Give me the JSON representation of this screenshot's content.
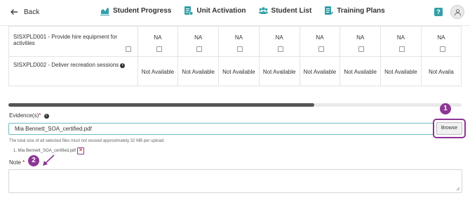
{
  "header": {
    "back_label": "Back",
    "nav": [
      {
        "label": "Student Progress",
        "icon": "chart-icon"
      },
      {
        "label": "Unit Activation",
        "icon": "document-icon"
      },
      {
        "label": "Student List",
        "icon": "users-icon"
      },
      {
        "label": "Training Plans",
        "icon": "document-list-icon"
      }
    ],
    "help_icon": "?"
  },
  "table": {
    "rows": [
      {
        "unit": "SISXPLD001 - Provide hire equipment for activities",
        "values": [
          "NA",
          "NA",
          "NA",
          "NA",
          "NA",
          "NA",
          "NA",
          "NA"
        ]
      },
      {
        "unit": "SISXPLD002 - Deliver recreation sessions",
        "values": [
          "Not Available",
          "Not Available",
          "Not Available",
          "Not Available",
          "Not Available",
          "Not Available",
          "Not Available",
          "Not Availa"
        ]
      }
    ]
  },
  "form": {
    "evidence_label": "Evidence(s)",
    "required_mark": "*",
    "file_value": "Mia Bennett_SOA_certified.pdf",
    "browse_label": "Browse",
    "hint": "The total size of all selected files must not exceed approximately 32 MB per upload.",
    "file_entry": "1. Mia Bennett_SOA_certified.pdf",
    "remove_glyph": "×",
    "note_label": "Note",
    "note_value": ""
  },
  "callouts": {
    "one": "1",
    "two": "2"
  },
  "colors": {
    "accent": "#33a0a8",
    "callout": "#8e3596",
    "input_border": "#6dbcc3"
  }
}
